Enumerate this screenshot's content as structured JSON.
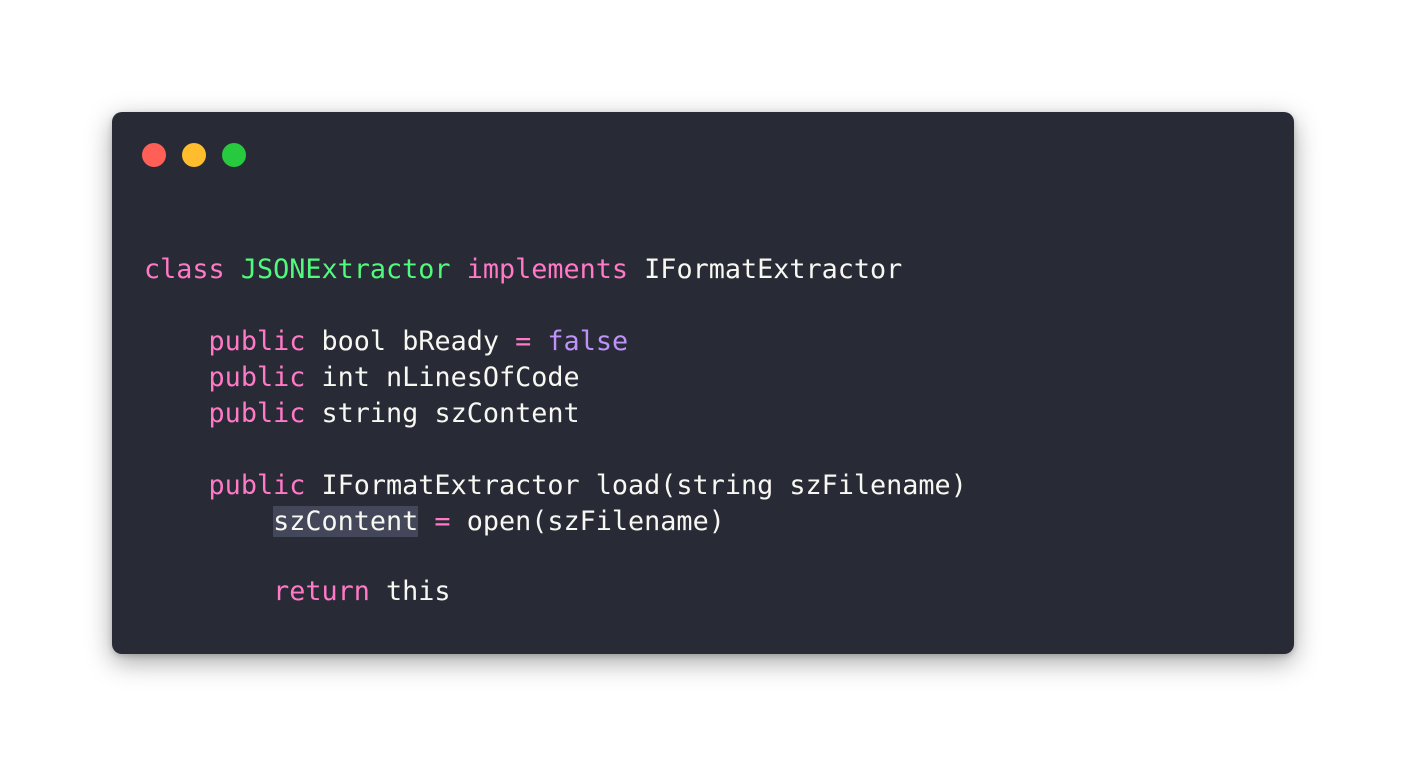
{
  "window": {
    "controls": [
      {
        "name": "close",
        "color": "#ff5f56"
      },
      {
        "name": "minimize",
        "color": "#ffbd2e"
      },
      {
        "name": "maximize",
        "color": "#27c93f"
      }
    ]
  },
  "code": {
    "line1": {
      "kw_class": "class",
      "class_name": "JSONExtractor",
      "kw_implements": "implements",
      "interface": "IFormatExtractor"
    },
    "line2": {
      "indent": "    ",
      "kw": "public",
      "type": "bool",
      "name": "bReady",
      "op": "=",
      "value": "false"
    },
    "line3": {
      "indent": "    ",
      "kw": "public",
      "type": "int",
      "name": "nLinesOfCode"
    },
    "line4": {
      "indent": "    ",
      "kw": "public",
      "type": "string",
      "name": "szContent"
    },
    "line5": {
      "indent": "    ",
      "kw": "public",
      "rest": "IFormatExtractor load(string szFilename)"
    },
    "line6": {
      "indent": "        ",
      "var": "szContent",
      "op": "=",
      "rest": "open(szFilename)"
    },
    "line7": {
      "indent": "        ",
      "kw": "return",
      "rest": "this"
    }
  }
}
